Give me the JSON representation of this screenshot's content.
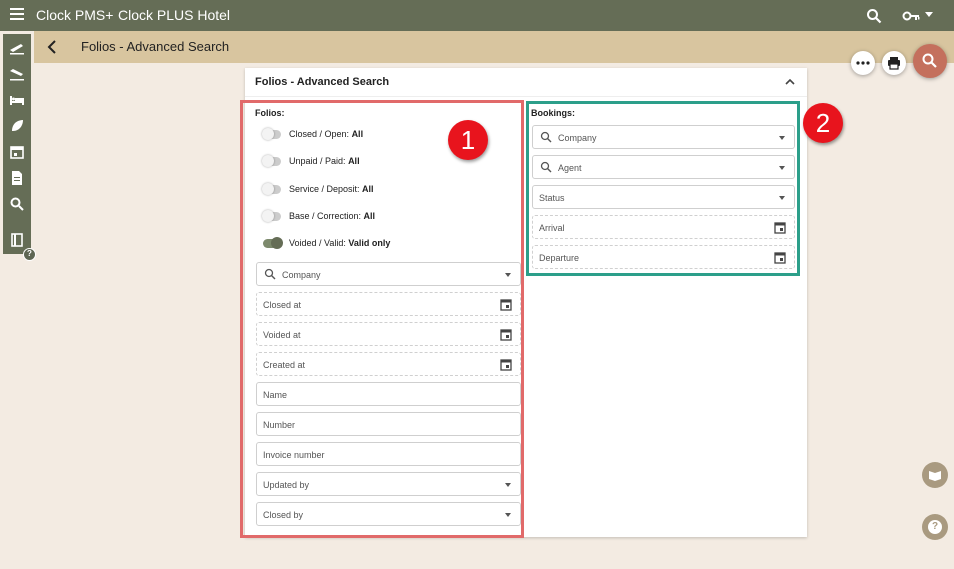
{
  "header": {
    "app_name": "Clock PMS+",
    "hotel_name": "Clock PLUS Hotel"
  },
  "subheader": {
    "title": "Folios - Advanced Search"
  },
  "sidebar": {
    "items": [
      "arrivals-icon",
      "departures-icon",
      "rooms-icon",
      "housekeeping-icon",
      "calendar-icon",
      "documents-icon",
      "search-icon",
      "book-icon"
    ],
    "help_badge": "?"
  },
  "panel": {
    "title": "Folios - Advanced Search"
  },
  "folios": {
    "label": "Folios:",
    "toggles": [
      {
        "label": "Closed / Open:",
        "value": "All",
        "on": false
      },
      {
        "label": "Unpaid / Paid:",
        "value": "All",
        "on": false
      },
      {
        "label": "Service / Deposit:",
        "value": "All",
        "on": false
      },
      {
        "label": "Base / Correction:",
        "value": "All",
        "on": false
      },
      {
        "label": "Voided / Valid:",
        "value": "Valid only",
        "on": true
      }
    ],
    "fields": {
      "company": "Company",
      "closed_at": "Closed at",
      "voided_at": "Voided at",
      "created_at": "Created at",
      "name": "Name",
      "number": "Number",
      "invoice_number": "Invoice number",
      "updated_by": "Updated by",
      "closed_by": "Closed by"
    }
  },
  "bookings": {
    "label": "Bookings:",
    "fields": {
      "company": "Company",
      "agent": "Agent",
      "status": "Status",
      "arrival": "Arrival",
      "departure": "Departure"
    }
  },
  "annotations": {
    "marker_1": "1",
    "marker_2": "2"
  },
  "colors": {
    "topbar": "#656d56",
    "subbar": "#d8c59f",
    "search_fab": "#c4705d",
    "highlight_red": "#e16a6a",
    "highlight_green": "#2c9f8a",
    "marker": "#e8141d"
  }
}
